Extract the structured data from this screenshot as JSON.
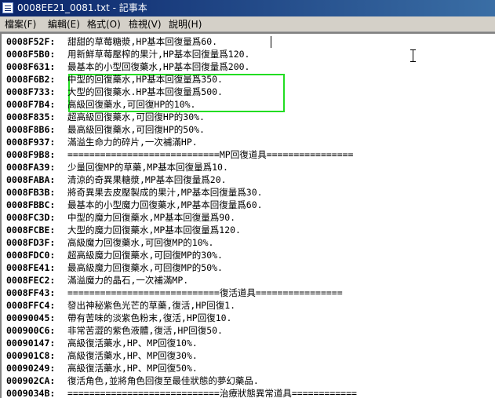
{
  "window": {
    "title": "0008EE21_0081.txt - 記事本",
    "icon": "notepad-icon"
  },
  "menu": [
    {
      "label": "檔案(F)"
    },
    {
      "label": "編輯(E)"
    },
    {
      "label": "格式(O)"
    },
    {
      "label": "檢視(V)"
    },
    {
      "label": "說明(H)"
    }
  ],
  "editor": {
    "highlight_color": "#22dd22",
    "lines": [
      {
        "addr": "0008F52F:",
        "text": "甜甜的草莓糖漿,HP基本回復量爲60."
      },
      {
        "addr": "0008F5B0:",
        "text": "用新鮮草莓壓榨的果汁,HP基本回復量爲120."
      },
      {
        "addr": "0008F631:",
        "text": "最基本的小型回復藥水,HP基本回復量爲200."
      },
      {
        "addr": "0008F6B2:",
        "text": "中型的回復藥水,HP基本回復量爲350."
      },
      {
        "addr": "0008F733:",
        "text": "大型的回復藥水.HP基本回復量爲500."
      },
      {
        "addr": "0008F7B4:",
        "text": "高級回復藥水,可回復HP的10%."
      },
      {
        "addr": "0008F835:",
        "text": "超高級回復藥水,可回復HP的30%."
      },
      {
        "addr": "0008F8B6:",
        "text": "最高級回復藥水,可回復HP的50%."
      },
      {
        "addr": "0008F937:",
        "text": "滿溢生命力的碎片,一次補滿HP."
      },
      {
        "addr": "0008F9B8:",
        "text": "============================MP回復道具================"
      },
      {
        "addr": "0008FA39:",
        "text": "少量回復MP的草藥,MP基本回復量爲10."
      },
      {
        "addr": "0008FABA:",
        "text": "清涼的奇異果糖漿,MP基本回復量爲20."
      },
      {
        "addr": "0008FB3B:",
        "text": "將奇異果去皮壓製成的果汁,MP基本回復量爲30."
      },
      {
        "addr": "0008FBBC:",
        "text": "最基本的小型魔力回復藥水,MP基本回復量爲60."
      },
      {
        "addr": "0008FC3D:",
        "text": "中型的魔力回復藥水,MP基本回復量爲90."
      },
      {
        "addr": "0008FCBE:",
        "text": "大型的魔力回復藥水,MP基本回復量爲120."
      },
      {
        "addr": "0008FD3F:",
        "text": "高級魔力回復藥水,可回復MP的10%."
      },
      {
        "addr": "0008FDC0:",
        "text": "超高級魔力回復藥水,可回復MP的30%."
      },
      {
        "addr": "0008FE41:",
        "text": "最高級魔力回復藥水,可回復MP的50%."
      },
      {
        "addr": "0008FEC2:",
        "text": "滿溢魔力的晶石,一次補滿MP."
      },
      {
        "addr": "0008FF43:",
        "text": "============================復活道具================"
      },
      {
        "addr": "0008FFC4:",
        "text": "發出神秘紫色光芒的草藥,復活,HP回復1."
      },
      {
        "addr": "00090045:",
        "text": "帶有苦味的淡紫色粉末,復活,HP回復10."
      },
      {
        "addr": "000900C6:",
        "text": "非常苦澀的紫色液體,復活,HP回復50."
      },
      {
        "addr": "00090147:",
        "text": "高級復活藥水,HP、MP回復10%."
      },
      {
        "addr": "000901C8:",
        "text": "高級復活藥水,HP、MP回復30%."
      },
      {
        "addr": "00090249:",
        "text": "高級復活藥水,HP、MP回復50%."
      },
      {
        "addr": "000902CA:",
        "text": "復活角色,並將角色回復至最佳狀態的夢幻藥品."
      },
      {
        "addr": "0009034B:",
        "text": "============================治療狀態異常道具============"
      }
    ]
  }
}
